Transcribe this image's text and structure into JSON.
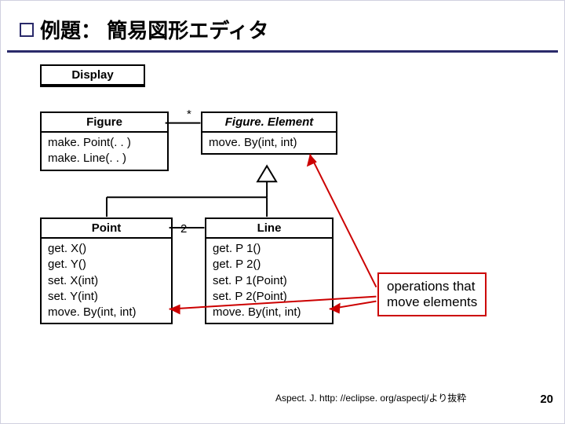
{
  "title": "例題： 簡易図形エディタ",
  "classes": {
    "display": {
      "name": "Display"
    },
    "figure": {
      "name": "Figure",
      "ops": "make. Point(. . )\nmake. Line(. . )"
    },
    "fe": {
      "name": "Figure. Element",
      "ops": "move. By(int, int)"
    },
    "point": {
      "name": "Point",
      "ops": "get. X()\nget. Y()\nset. X(int)\nset. Y(int)\nmove. By(int, int)"
    },
    "line": {
      "name": "Line",
      "ops": "get. P 1()\nget. P 2()\nset. P 1(Point)\nset. P 2(Point)\nmove. By(int, int)"
    }
  },
  "mult": {
    "star": "*",
    "two": "2"
  },
  "note": "operations that\nmove elements",
  "citation": "Aspect. J. http: //eclipse. org/aspectj/より抜粋",
  "page": "20"
}
